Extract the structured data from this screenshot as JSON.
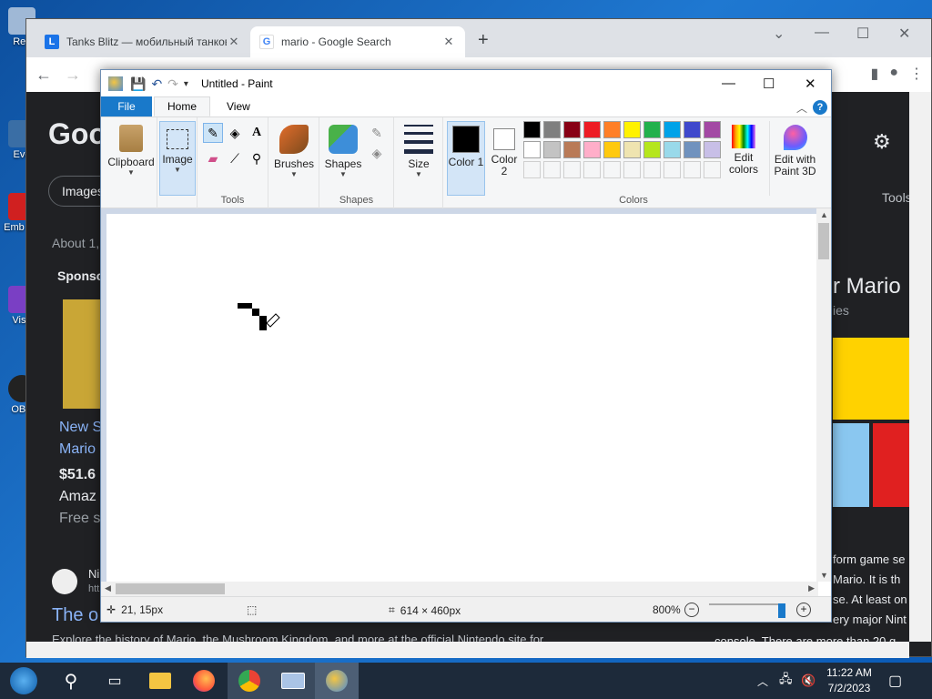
{
  "desktop": {
    "icons": [
      "Rec",
      "Eve",
      "Emb De",
      "Visu",
      "OBS"
    ]
  },
  "chrome": {
    "tabs": [
      {
        "title": "Tanks Blitz — мобильный танков",
        "favicon": "L"
      },
      {
        "title": "mario - Google Search",
        "favicon": "G"
      }
    ],
    "page_fragments": {
      "logo": "Goo",
      "images_chip": "Images",
      "about": "About 1,",
      "sponsored": "Sponso",
      "tools": "Tools",
      "new": "New S",
      "mario": "Mario",
      "price": "$51.6",
      "amazon": "Amaz",
      "free": "Free s",
      "ni": "Ni",
      "htt": "htt",
      "the": "The o",
      "explore": "Explore the history of Mario, the Mushroom Kingdom, and more at the official Nintendo site for",
      "r_mario": "r Mario",
      "ies": "ies",
      "platform": "form game se",
      "mario_it": "Mario. It is th",
      "se_at": "se. At least on",
      "very_major": "ery major Nint",
      "console": "console. There are more than 20 g"
    }
  },
  "paint": {
    "title": "Untitled - Paint",
    "tabs": {
      "file": "File",
      "home": "Home",
      "view": "View"
    },
    "ribbon": {
      "clipboard": "Clipboard",
      "image": "Image",
      "tools": "Tools",
      "brushes": "Brushes",
      "shapes_btn": "Shapes",
      "shapes_group": "Shapes",
      "size": "Size",
      "color1": "Color 1",
      "color2": "Color 2",
      "edit_colors": "Edit colors",
      "edit_paint3d": "Edit with Paint 3D",
      "colors_group": "Colors"
    },
    "palette_row1": [
      "#000000",
      "#7f7f7f",
      "#880015",
      "#ed1c24",
      "#ff7f27",
      "#fff200",
      "#22b14c",
      "#00a2e8",
      "#3f48cc",
      "#a349a4"
    ],
    "palette_row2": [
      "#ffffff",
      "#c3c3c3",
      "#b97a57",
      "#ffaec9",
      "#ffc90e",
      "#efe4b0",
      "#b5e61d",
      "#99d9ea",
      "#7092be",
      "#c8bfe7"
    ],
    "color1_value": "#000000",
    "color2_value": "#ffffff",
    "status": {
      "cursor_pos": "21, 15px",
      "selection": "",
      "canvas_size": "614 × 460px",
      "zoom": "800%"
    }
  },
  "taskbar": {
    "time": "11:22 AM",
    "date": "7/2/2023"
  }
}
